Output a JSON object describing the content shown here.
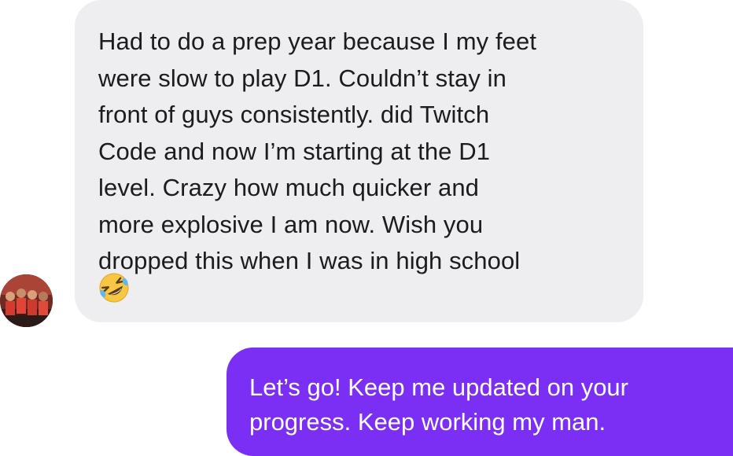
{
  "conversation": {
    "incoming_message": {
      "text": "Had to do a prep year because I my feet\nwere slow to play D1. Couldn’t stay in\nfront of guys consistently. did Twitch\nCode and now I’m starting at the D1\nlevel. Crazy how much quicker and\nmore explosive I am now. Wish you\ndropped this when I was in high school",
      "emoji": "rolling-on-the-floor-laughing-emoji",
      "bubble_color": "#eeeef0",
      "text_color": "#1c1c1e"
    },
    "sender_avatar": {
      "icon": "group-photo-avatar"
    },
    "outgoing_message": {
      "text": "Let’s go! Keep me updated on your\nprogress. Keep working my man.",
      "bubble_color": "#7b2ff5",
      "text_color": "#ffffff"
    }
  }
}
